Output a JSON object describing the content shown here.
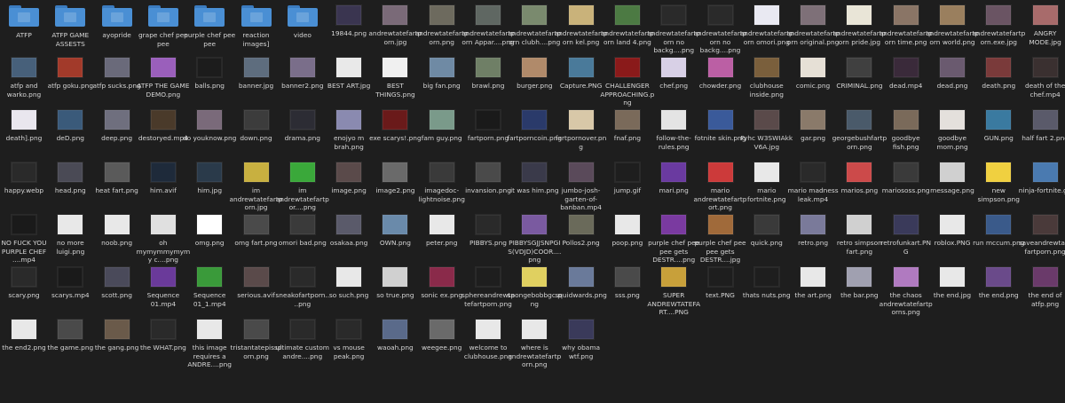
{
  "rows": [
    [
      {
        "name": "ATFP",
        "type": "folder"
      },
      {
        "name": "ATFP GAME ASSESTS",
        "type": "folder"
      },
      {
        "name": "ayopride",
        "type": "folder"
      },
      {
        "name": "grape chef pee pee",
        "type": "folder"
      },
      {
        "name": "purple chef pee pee",
        "type": "folder"
      },
      {
        "name": "reaction images]",
        "type": "folder"
      },
      {
        "name": "video",
        "type": "folder"
      },
      {
        "name": "19844.png",
        "type": "image",
        "color": "#3a3550"
      },
      {
        "name": "andrewtatefartporn.jpg",
        "type": "image",
        "color": "#7a6a78"
      },
      {
        "name": "andrewtatefartporn.png",
        "type": "image",
        "color": "#6d6a5e"
      },
      {
        "name": "andrewtatefartporn Appar....png",
        "type": "image",
        "color": "#5f6762"
      },
      {
        "name": "andrewtatefartporn clubh....png",
        "type": "image",
        "color": "#7a8a6e"
      },
      {
        "name": "andrewtatefartporn kel.png",
        "type": "image",
        "color": "#c9b27a"
      },
      {
        "name": "andrewtatefartporn land 4.png",
        "type": "image",
        "color": "#4c7a43"
      },
      {
        "name": "andrewtatefartporn no backg....png",
        "type": "image",
        "color": "#2a2a2a"
      },
      {
        "name": "andrewtatefartporn no backg....png",
        "type": "image",
        "color": "#2a2a2a"
      },
      {
        "name": "andrewtatefartporn omori.png",
        "type": "image",
        "color": "#e9e9f2"
      },
      {
        "name": "andrewtatefartporn original.png",
        "type": "image",
        "color": "#7e7078"
      },
      {
        "name": "andrewtatefartporn pride.jpg",
        "type": "image",
        "color": "#e9e5d7"
      },
      {
        "name": "andrewtatefartporn time.png",
        "type": "image",
        "color": "#8a7566"
      },
      {
        "name": "andrewtatefartporn world.png",
        "type": "image",
        "color": "#9a7f5e"
      },
      {
        "name": "andrewtatefartporn.exe.jpg",
        "type": "image",
        "color": "#6a5463"
      },
      {
        "name": "ANGRY MODE.jpg",
        "type": "image",
        "color": "#a86b6b"
      }
    ],
    [
      {
        "name": "atfp and warko.png",
        "type": "image",
        "color": "#47607a"
      },
      {
        "name": "atfp goku.png",
        "type": "image",
        "color": "#a23a2a"
      },
      {
        "name": "atfp sucks.png",
        "type": "image",
        "color": "#6a6a7a"
      },
      {
        "name": "ATFP THE GAME DEMO.png",
        "type": "image",
        "color": "#9a5fbb"
      },
      {
        "name": "balls.png",
        "type": "image",
        "color": "#1c1c1c"
      },
      {
        "name": "banner.jpg",
        "type": "image",
        "color": "#5e6d7e"
      },
      {
        "name": "banner2.png",
        "type": "image",
        "color": "#7a6e8a"
      },
      {
        "name": "BEST ART.jpg",
        "type": "image",
        "color": "#e9e9e9"
      },
      {
        "name": "BEST THINGS.png",
        "type": "image",
        "color": "#f0f0f0"
      },
      {
        "name": "big fan.png",
        "type": "image",
        "color": "#6f8aa4"
      },
      {
        "name": "brawl.png",
        "type": "image",
        "color": "#6f7f66"
      },
      {
        "name": "burger.png",
        "type": "image",
        "color": "#b08a6a"
      },
      {
        "name": "Capture.PNG",
        "type": "image",
        "color": "#4a7a9a"
      },
      {
        "name": "CHALLENGER APPROACHING.png",
        "type": "image",
        "color": "#8a1a1a"
      },
      {
        "name": "chef.png",
        "type": "image",
        "color": "#d8d0e6"
      },
      {
        "name": "chowder.png",
        "type": "image",
        "color": "#bb5fa4"
      },
      {
        "name": "clubhouse inside.png",
        "type": "image",
        "color": "#7a5f3c"
      },
      {
        "name": "comic.png",
        "type": "image",
        "color": "#e6e0d6"
      },
      {
        "name": "CRIMINAL.png",
        "type": "image",
        "color": "#404040"
      },
      {
        "name": "dead.mp4",
        "type": "image",
        "color": "#3a2a3a"
      },
      {
        "name": "dead.png",
        "type": "image",
        "color": "#6a5a6f"
      },
      {
        "name": "death.png",
        "type": "image",
        "color": "#7a3a3a"
      },
      {
        "name": "death of the chef.mp4",
        "type": "image",
        "color": "#3a3030"
      }
    ],
    [
      {
        "name": "death].png",
        "type": "image",
        "color": "#e9e6ee"
      },
      {
        "name": "deD.png",
        "type": "image",
        "color": "#3a5a7a"
      },
      {
        "name": "deep.png",
        "type": "image",
        "color": "#6f6f7e"
      },
      {
        "name": "destoryed.mp4",
        "type": "image",
        "color": "#4a3a2a"
      },
      {
        "name": "do youknow.png",
        "type": "image",
        "color": "#7a6a7a"
      },
      {
        "name": "down.png",
        "type": "image",
        "color": "#3c3c3c"
      },
      {
        "name": "drama.png",
        "type": "image",
        "color": "#2c2c34"
      },
      {
        "name": "enojyo m brah.png",
        "type": "image",
        "color": "#8a8ab0"
      },
      {
        "name": "exe scarys!.png",
        "type": "image",
        "color": "#6a1a1a"
      },
      {
        "name": "fam guy.png",
        "type": "image",
        "color": "#7a9a8a"
      },
      {
        "name": "fartporn.png",
        "type": "image",
        "color": "#1a1a1a"
      },
      {
        "name": "fartporncoin.png",
        "type": "image",
        "color": "#2a3a6a"
      },
      {
        "name": "fartpornover.png",
        "type": "image",
        "color": "#d8c8a8"
      },
      {
        "name": "fnaf.png",
        "type": "image",
        "color": "#7a6a5a"
      },
      {
        "name": "follow-the-rules.png",
        "type": "image",
        "color": "#e4e4e4"
      },
      {
        "name": "fotnite skin.png",
        "type": "image",
        "color": "#3a5a9a"
      },
      {
        "name": "Fyhc W3SWIAkk V6A.jpg",
        "type": "image",
        "color": "#5a4a4a"
      },
      {
        "name": "gar.png",
        "type": "image",
        "color": "#8a7a6a"
      },
      {
        "name": "georgebushfartporn.png",
        "type": "image",
        "color": "#4a5a6a"
      },
      {
        "name": "goodbye fish.png",
        "type": "image",
        "color": "#7a6a5a"
      },
      {
        "name": "goodbye mom.png",
        "type": "image",
        "color": "#e4e0dc"
      },
      {
        "name": "GUN.png",
        "type": "image",
        "color": "#3a7aa0"
      },
      {
        "name": "half fart 2.png",
        "type": "image",
        "color": "#5a5a6a"
      }
    ],
    [
      {
        "name": "happy.webp",
        "type": "image",
        "color": "#2a2a2a"
      },
      {
        "name": "head.png",
        "type": "image",
        "color": "#4a4a55"
      },
      {
        "name": "heat fart.png",
        "type": "image",
        "color": "#5a5a5a"
      },
      {
        "name": "him.avif",
        "type": "image",
        "color": "#1e2a3a"
      },
      {
        "name": "him.jpg",
        "type": "image",
        "color": "#2a3a4a"
      },
      {
        "name": "im andrewtatefartporn.jpg",
        "type": "image",
        "color": "#c8b040"
      },
      {
        "name": "im andrewtatefartpor....png",
        "type": "image",
        "color": "#3aa83a"
      },
      {
        "name": "image.png",
        "type": "image",
        "color": "#5a4a4a"
      },
      {
        "name": "image2.png",
        "type": "image",
        "color": "#6a6a6a"
      },
      {
        "name": "imagedoc-lightnoise.png",
        "type": "image",
        "color": "#3a3a3a"
      },
      {
        "name": "invansion.png",
        "type": "image",
        "color": "#4a4a4a"
      },
      {
        "name": "it was him.png",
        "type": "image",
        "color": "#3a3a4a"
      },
      {
        "name": "jumbo-josh-garten-of-banban.mp4",
        "type": "image",
        "color": "#5a4a5a"
      },
      {
        "name": "jump.gif",
        "type": "image",
        "color": "#1e1e1e"
      },
      {
        "name": "mari.png",
        "type": "image",
        "color": "#6a3aa0"
      },
      {
        "name": "mario andrewtatefartport.png",
        "type": "image",
        "color": "#cc3a3a"
      },
      {
        "name": "mario fortnite.png",
        "type": "image",
        "color": "#e8e8e8"
      },
      {
        "name": "mario madness leak.mp4",
        "type": "image",
        "color": "#2a2a2a"
      },
      {
        "name": "marios.png",
        "type": "image",
        "color": "#cc4a4a"
      },
      {
        "name": "mariososs.png",
        "type": "image",
        "color": "#3a3a3a"
      },
      {
        "name": "message.png",
        "type": "image",
        "color": "#d0d0d0"
      },
      {
        "name": "new simpson.png",
        "type": "image",
        "color": "#f0d040"
      },
      {
        "name": "ninja-fortnite.gif",
        "type": "image",
        "color": "#4a7ab0"
      }
    ],
    [
      {
        "name": "NO FUCK YOU PURPLE CHEF ....mp4",
        "type": "image",
        "color": "#1a1a1a"
      },
      {
        "name": "no more luigi.png",
        "type": "image",
        "color": "#e8e8e8"
      },
      {
        "name": "noob.png",
        "type": "image",
        "color": "#e8e8e8"
      },
      {
        "name": "oh mymymmymymy c....png",
        "type": "image",
        "color": "#e0e0e0"
      },
      {
        "name": "omg.png",
        "type": "image",
        "color": "#ffffff"
      },
      {
        "name": "omg fart.png",
        "type": "image",
        "color": "#4a4a4a"
      },
      {
        "name": "omori bad.png",
        "type": "image",
        "color": "#3a3a3a"
      },
      {
        "name": "osakaa.png",
        "type": "image",
        "color": "#5a5a6a"
      },
      {
        "name": "OWN.png",
        "type": "image",
        "color": "#6a8aaa"
      },
      {
        "name": "peter.png",
        "type": "image",
        "color": "#e8e8e8"
      },
      {
        "name": "PIBBYS.png",
        "type": "image",
        "color": "#2a2a2a"
      },
      {
        "name": "PIBBYSGJJSNPGIS(VDJD)COOR....png",
        "type": "image",
        "color": "#7a5aa0"
      },
      {
        "name": "Pollos2.png",
        "type": "image",
        "color": "#6a6a5a"
      },
      {
        "name": "poop.png",
        "type": "image",
        "color": "#e8e8e8"
      },
      {
        "name": "purple chef pee pee gets DESTR....png",
        "type": "image",
        "color": "#7a3aa0"
      },
      {
        "name": "purple chef pee pee gets DESTR....jpg",
        "type": "image",
        "color": "#a06a3a"
      },
      {
        "name": "quick.png",
        "type": "image",
        "color": "#3a3a3a"
      },
      {
        "name": "retro.png",
        "type": "image",
        "color": "#7a7a9a"
      },
      {
        "name": "retro simpson fart.png",
        "type": "image",
        "color": "#d0d0d0"
      },
      {
        "name": "retrofunkart.PNG",
        "type": "image",
        "color": "#3a3a5a"
      },
      {
        "name": "roblox.PNG",
        "type": "image",
        "color": "#e8e8e8"
      },
      {
        "name": "run mccum.png",
        "type": "image",
        "color": "#3a5a8a"
      },
      {
        "name": "saveandrewtatefartporn.png",
        "type": "image",
        "color": "#4a3a3a"
      }
    ],
    [
      {
        "name": "scary.png",
        "type": "image",
        "color": "#2a2a2a"
      },
      {
        "name": "scarys.mp4",
        "type": "image",
        "color": "#1a1a1a"
      },
      {
        "name": "scott.png",
        "type": "image",
        "color": "#4a4a5a"
      },
      {
        "name": "Sequence 01.mp4",
        "type": "image",
        "color": "#6a3a9a"
      },
      {
        "name": "Sequence 01_1.mp4",
        "type": "image",
        "color": "#3a9a3a"
      },
      {
        "name": "serious.avif",
        "type": "image",
        "color": "#5a4a4a"
      },
      {
        "name": "sneakofartporn....png",
        "type": "image",
        "color": "#2a2a2a"
      },
      {
        "name": "so such.png",
        "type": "image",
        "color": "#e8e8e8"
      },
      {
        "name": "so true.png",
        "type": "image",
        "color": "#d0d0d0"
      },
      {
        "name": "sonic ex.png",
        "type": "image",
        "color": "#8a2a4a"
      },
      {
        "name": "sphereandrewtatefartporn.png",
        "type": "image",
        "color": "#1e1e1e"
      },
      {
        "name": "spongebobbgc.png",
        "type": "image",
        "color": "#e0d060"
      },
      {
        "name": "squidwards.png",
        "type": "image",
        "color": "#6a7a9a"
      },
      {
        "name": "sss.png",
        "type": "image",
        "color": "#4a4a4a"
      },
      {
        "name": "SUPER ANDREWTATEFART....PNG",
        "type": "image",
        "color": "#c8a03a"
      },
      {
        "name": "text.PNG",
        "type": "image",
        "color": "#1e1e1e"
      },
      {
        "name": "thats nuts.png",
        "type": "image",
        "color": "#1e1e1e"
      },
      {
        "name": "the art.png",
        "type": "image",
        "color": "#e8e8e8"
      },
      {
        "name": "the bar.png",
        "type": "image",
        "color": "#a0a0b0"
      },
      {
        "name": "the chaos andrewtatefartporns.png",
        "type": "image",
        "color": "#b07ac0"
      },
      {
        "name": "the end.jpg",
        "type": "image",
        "color": "#e8e8e8"
      },
      {
        "name": "the end.png",
        "type": "image",
        "color": "#6a4a8a"
      },
      {
        "name": "the end of atfp.png",
        "type": "image",
        "color": "#6a3a6a"
      }
    ],
    [
      {
        "name": "the end2.png",
        "type": "image",
        "color": "#e8e8e8"
      },
      {
        "name": "the game.png",
        "type": "image",
        "color": "#4a4a4a"
      },
      {
        "name": "the gang.png",
        "type": "image",
        "color": "#6a5a4a"
      },
      {
        "name": "the WHAT.png",
        "type": "image",
        "color": "#2a2a2a"
      },
      {
        "name": "this image requires a ANDRE....png",
        "type": "image",
        "color": "#e8e8e8"
      },
      {
        "name": "tristantatepissporn.png",
        "type": "image",
        "color": "#4a4a4a"
      },
      {
        "name": "ultimate custom andre....png",
        "type": "image",
        "color": "#2a2a2a"
      },
      {
        "name": "vs mouse peak.png",
        "type": "image",
        "color": "#2a2a2a"
      },
      {
        "name": "waoah.png",
        "type": "image",
        "color": "#5a6a8a"
      },
      {
        "name": "weegee.png",
        "type": "image",
        "color": "#6a6a6a"
      },
      {
        "name": "welcome to clubhouse.png",
        "type": "image",
        "color": "#e8e8e8"
      },
      {
        "name": "where is andrewtatefartporn.png",
        "type": "image",
        "color": "#e8e8e8"
      },
      {
        "name": "why obama wtf.png",
        "type": "image",
        "color": "#3a3a5a"
      }
    ]
  ],
  "folder_color": "#4a8fd4",
  "folder_tab_color": "#3b7bbf",
  "background": "#1e1e1e"
}
